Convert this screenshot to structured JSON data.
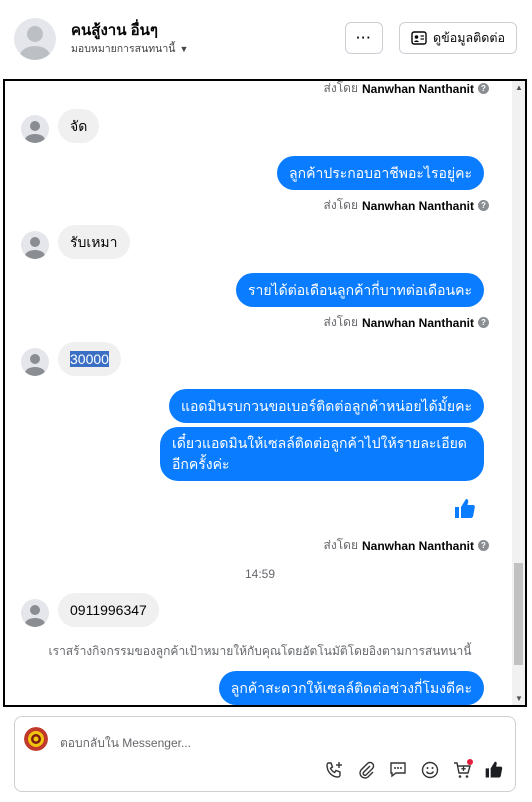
{
  "header": {
    "name": "คนสู้งาน อื่นๆ",
    "assign_label": "มอบหมายการสนทนานี้",
    "more_label": "···",
    "contact_label": "ดูข้อมูลติดต่อ"
  },
  "messages": {
    "sent_prefix": "ส่งโดย",
    "sender_name": "Nanwhan Nanthanit",
    "m1": "จัด",
    "m2": "ลูกค้าประกอบอาชีพอะไรอยู่คะ",
    "m3": "รับเหมา",
    "m4": "รายได้ต่อเดือนลูกค้ากี่บาทต่อเดือนคะ",
    "m5": "30000",
    "m6": "แอดมินรบกวนขอเบอร์ติดต่อลูกค้าหน่อยได้มั้ยคะ",
    "m7": "เดี๋ยวแอดมินให้เซลล์ติดต่อลูกค้าไปให้รายละเอียดอีกครั้งค่ะ",
    "time": "14:59",
    "m8": "0911996347",
    "notice": "เราสร้างกิจกรรมของลูกค้าเป้าหมายให้กับคุณโดยอัตโนมัติโดยอิงตามการสนทนานี้",
    "m9": "ลูกค้าสะดวกให้เซลล์ติดต่อช่วงกี่โมงดีคะ"
  },
  "composer": {
    "placeholder": "ตอบกลับใน Messenger..."
  },
  "colors": {
    "outgoing": "#0a7cff",
    "incoming": "#f0f0f0",
    "notification_dot": "#e41e3f"
  },
  "icons": [
    "phone-add-icon",
    "attachment-icon",
    "saved-reply-icon",
    "emoji-icon",
    "cart-icon",
    "like-icon"
  ]
}
